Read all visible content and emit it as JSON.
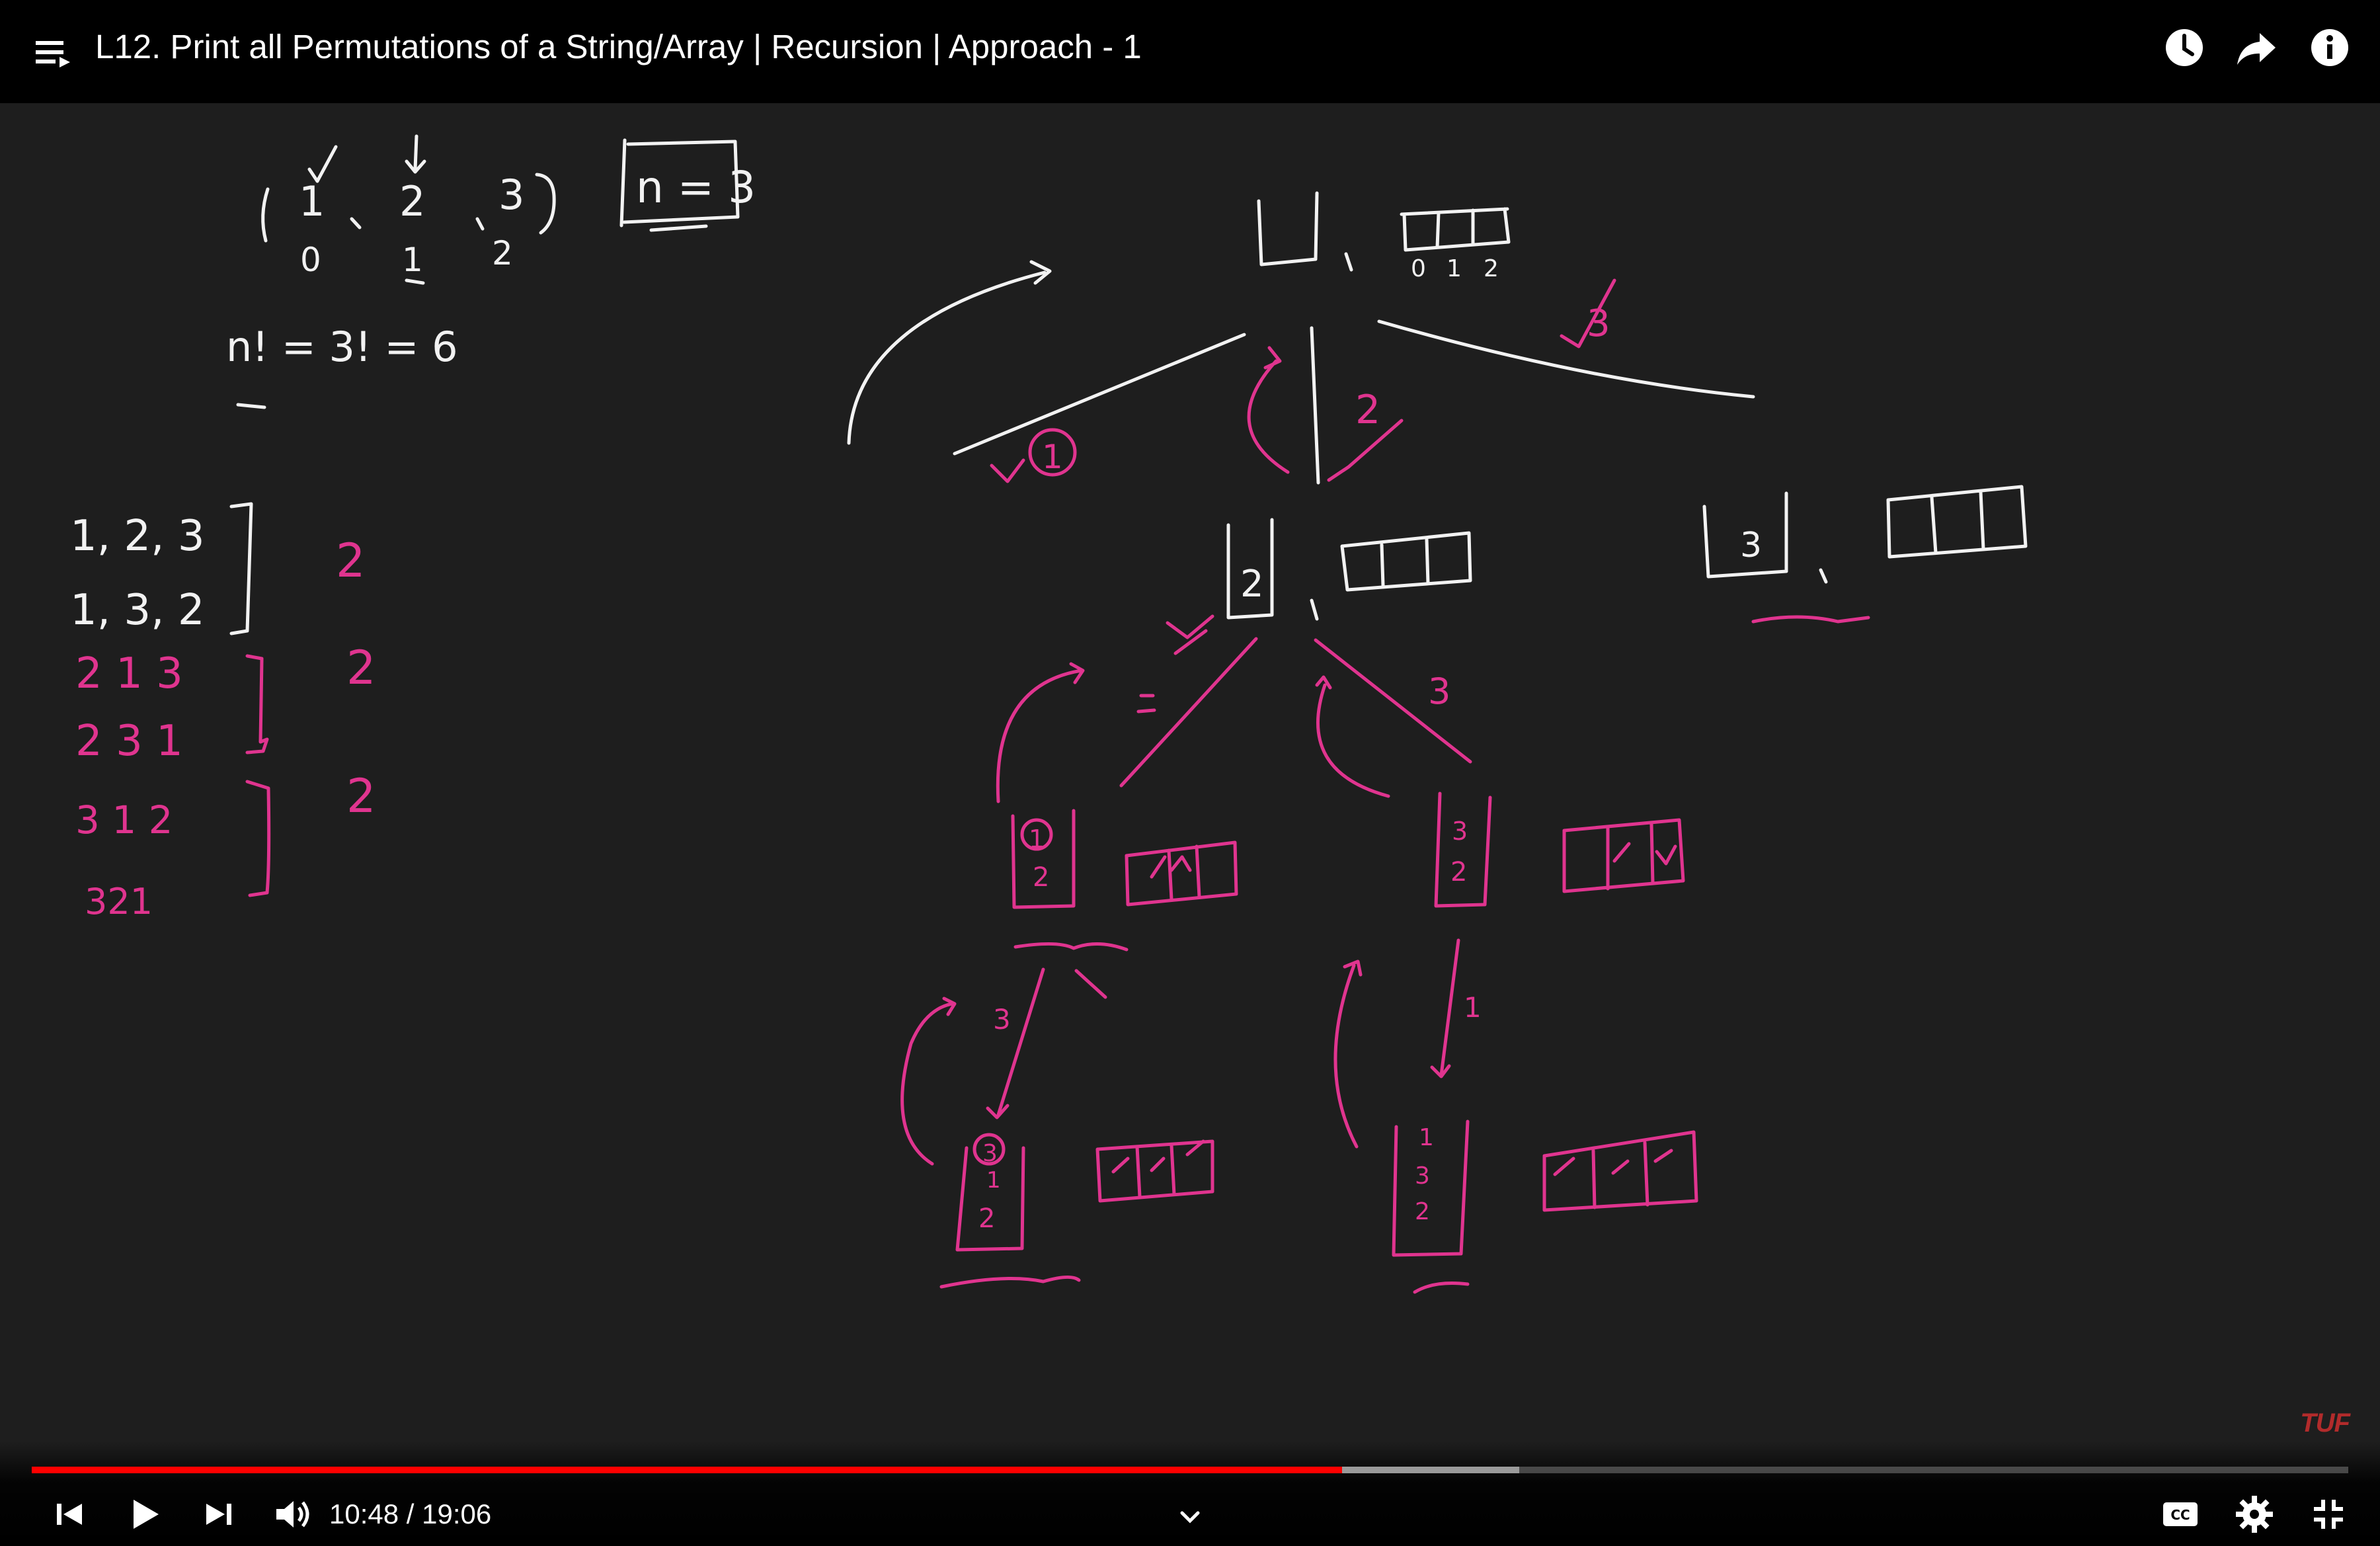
{
  "header": {
    "title": "L12. Print all Permutations of a String/Array | Recursion | Approach - 1",
    "icons": [
      "playlist-icon",
      "watch-later-icon",
      "share-icon",
      "info-icon"
    ]
  },
  "whiteboard": {
    "array_values": [
      "1",
      "2",
      "3"
    ],
    "array_indices": [
      "0",
      "1",
      "2"
    ],
    "n_label": "n = 3",
    "factorial": "n! = 3! = 6",
    "perm_rows": [
      "1, 2, 3",
      "1, 3, 2",
      "2 1 3",
      "2 3 1",
      "3 1 2",
      "321"
    ],
    "perm_group_counts": [
      "2",
      "2",
      "2"
    ],
    "root_ds_label": "[ ]",
    "root_freq_indices": [
      "0",
      "1",
      "2"
    ],
    "branch_labels": [
      "1",
      "2",
      "3"
    ],
    "level1_ds": [
      "2",
      "3"
    ],
    "level2_branch_labels": [
      "1",
      "3"
    ],
    "level2_ds": [
      [
        "1",
        "2"
      ],
      [
        "3",
        "2"
      ]
    ],
    "level3_branch_labels": [
      "3",
      "1"
    ],
    "level3_ds": [
      [
        "3",
        "1",
        "2"
      ],
      [
        "1",
        "3",
        "2"
      ]
    ],
    "ink_colors": {
      "white": "#f2f2f2",
      "pink": "#e0348f"
    }
  },
  "watermark": "TUF",
  "player": {
    "current_time": "10:48",
    "duration": "19:06",
    "time_display": "10:48 / 19:06",
    "played_fraction": 0.5656,
    "buffered_fraction": 0.642,
    "colors": {
      "played": "#ff0000",
      "buffer": "#aaaaaa"
    },
    "left_controls": [
      "previous-icon",
      "play-icon",
      "next-icon",
      "volume-icon"
    ],
    "right_controls": [
      "captions-icon",
      "settings-icon",
      "exit-fullscreen-icon"
    ]
  }
}
